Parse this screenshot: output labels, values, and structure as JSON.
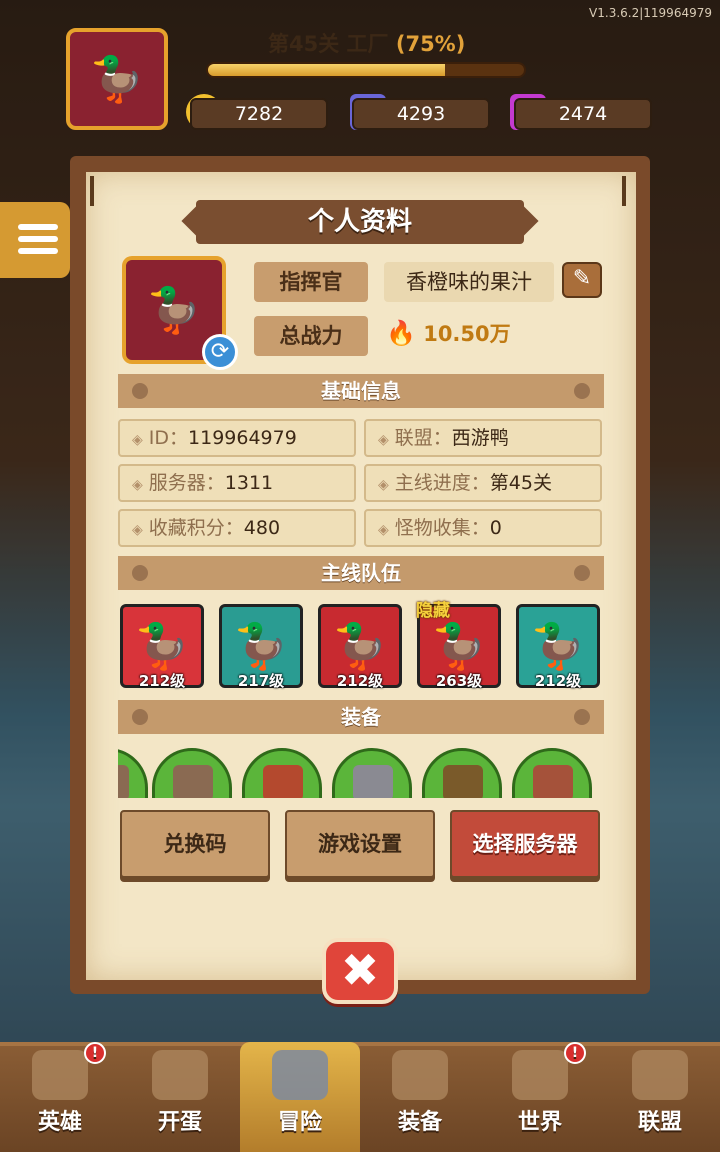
{
  "version": "V1.3.6.2|119964979",
  "header": {
    "level_title": "第45关 工厂",
    "level_pct": "(75%)",
    "progress": 0.75,
    "gold": "7282",
    "gems_blue": "4293",
    "gems_purple": "2474",
    "power": "10.50万"
  },
  "profile": {
    "title": "个人资料",
    "commander_label": "指挥官",
    "commander_name": "香橙味的果汁",
    "power_label": "总战力",
    "power_value": "10.50万"
  },
  "basic_info": {
    "header": "基础信息",
    "id_key": "ID：",
    "id_val": "119964979",
    "alliance_key": "联盟：",
    "alliance_val": "西游鸭",
    "server_key": "服务器：",
    "server_val": "1311",
    "progress_key": "主线进度：",
    "progress_val": "第45关",
    "collect_key": "收藏积分：",
    "collect_val": "480",
    "monster_key": "怪物收集：",
    "monster_val": "0"
  },
  "team": {
    "header": "主线队伍",
    "hidden_tag": "隐藏",
    "heroes": [
      {
        "level": "212级",
        "color": "#d8343a"
      },
      {
        "level": "217级",
        "color": "#2a9c92"
      },
      {
        "level": "212级",
        "color": "#c82a30"
      },
      {
        "level": "263级",
        "color": "#c82a30"
      },
      {
        "level": "212级",
        "color": "#2aa296"
      }
    ]
  },
  "equipment": {
    "header": "装备"
  },
  "actions": {
    "redeem": "兑换码",
    "settings": "游戏设置",
    "server": "选择服务器"
  },
  "close_symbol": "✖",
  "nav": {
    "hero": "英雄",
    "egg": "开蛋",
    "adventure": "冒险",
    "equip": "装备",
    "world": "世界",
    "alliance": "联盟",
    "badge": "!"
  }
}
